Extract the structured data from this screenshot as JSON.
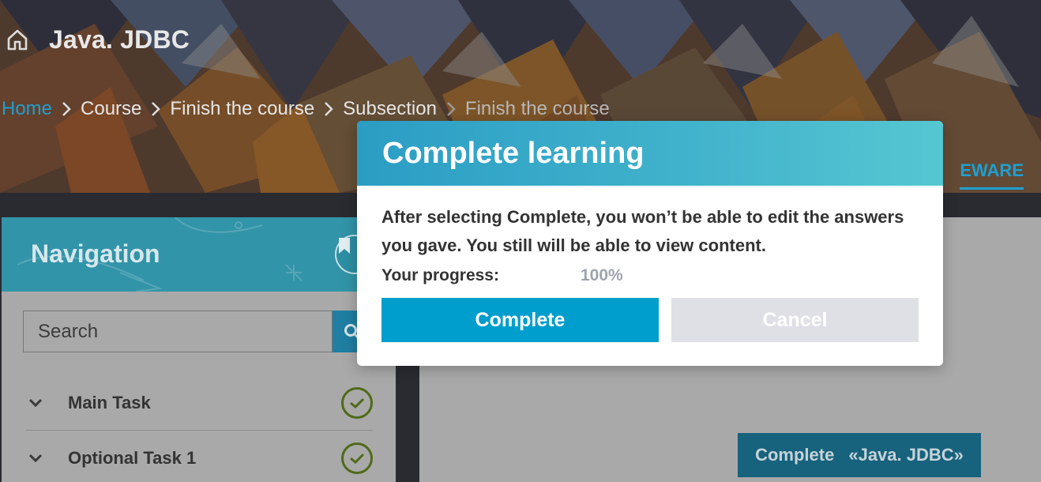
{
  "header": {
    "home_icon": "home-icon",
    "course_title": "Java. JDBC",
    "breadcrumb": [
      {
        "label": "Home"
      },
      {
        "label": "Course"
      },
      {
        "label": "Finish the course"
      },
      {
        "label": "Subsection"
      },
      {
        "label": "Finish the course"
      }
    ],
    "active_tab": "EWARE"
  },
  "sidebar": {
    "title": "Navigation",
    "bookmark_icon": "bookmark-icon",
    "search": {
      "placeholder": "Search",
      "value": "",
      "icon": "search-icon"
    },
    "items": [
      {
        "label": "Main Task",
        "status": "completed"
      },
      {
        "label": "Optional Task 1",
        "status": "completed"
      }
    ]
  },
  "main": {
    "complete_button": {
      "label": "Complete",
      "course": "«Java. JDBC»"
    }
  },
  "modal": {
    "title": "Complete learning",
    "message": "After selecting Complete, you won’t be able to edit the answers you gave. You still will be able to view content.",
    "progress_label": "Your progress:",
    "progress_value": "100%",
    "confirm_label": "Complete",
    "cancel_label": "Cancel"
  },
  "colors": {
    "accent": "#009ecc",
    "modal_header_start": "#2b9dc4",
    "modal_header_end": "#55c7d2",
    "link": "#1f9fd0",
    "success": "#4f6a18"
  }
}
